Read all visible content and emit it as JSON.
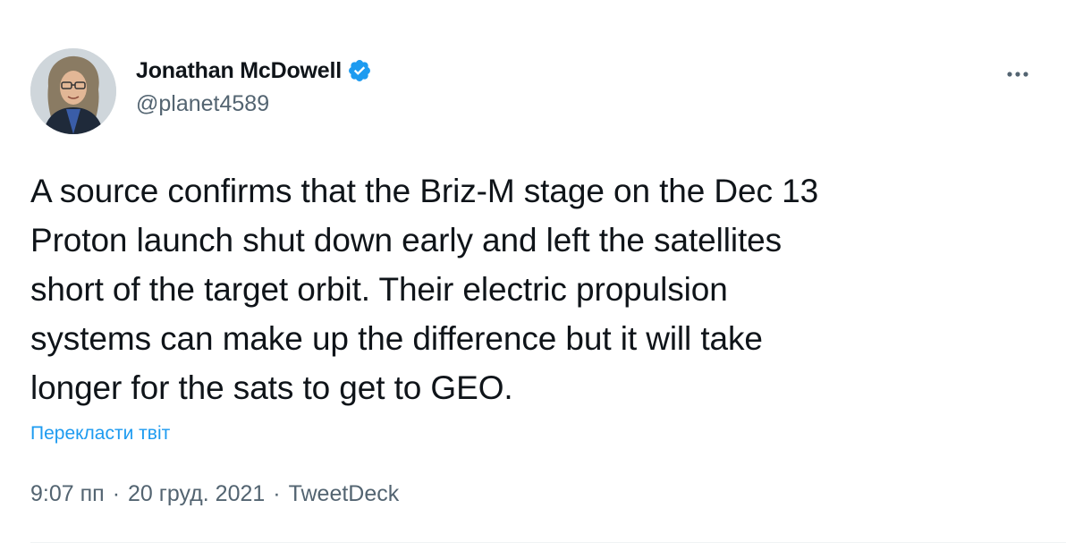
{
  "author": {
    "display_name": "Jonathan McDowell",
    "handle": "@planet4589",
    "verified": true,
    "verified_color": "#1d9bf0"
  },
  "more_button": {
    "icon": "more-horizontal-icon"
  },
  "tweet": {
    "text": "A source confirms that the Briz-M stage on the Dec 13\nProton launch shut down early and left the satellites\nshort of the target orbit. Their electric propulsion\nsystems can make up the difference but it will take\nlonger for the sats to get to GEO.",
    "translate_label": "Перекласти твіт",
    "time": "9:07 пп",
    "separator": "·",
    "date": "20 груд. 2021",
    "source": "TweetDeck"
  },
  "colors": {
    "text_primary": "#0f1419",
    "text_secondary": "#536471",
    "link": "#1d9bf0",
    "divider": "#eff3f4"
  }
}
